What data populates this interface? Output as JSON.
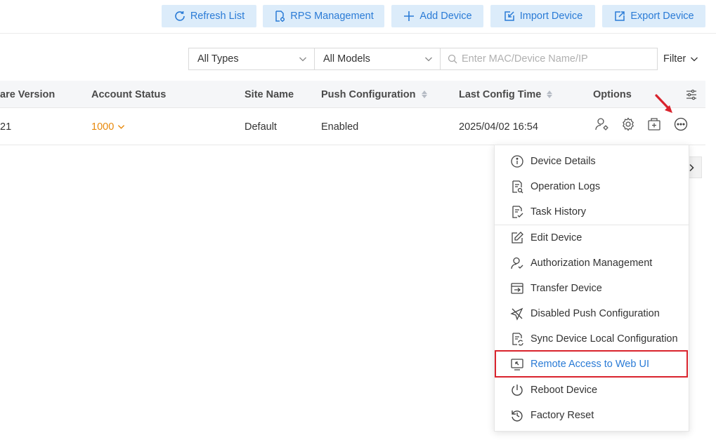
{
  "toolbar": {
    "refresh": "Refresh List",
    "rps": "RPS Management",
    "add": "Add Device",
    "import": "Import Device",
    "export": "Export Device"
  },
  "filters": {
    "types": "All Types",
    "models": "All Models",
    "search_placeholder": "Enter MAC/Device Name/IP",
    "filter": "Filter"
  },
  "table": {
    "headers": {
      "firmware": "are Version",
      "account_status": "Account Status",
      "site_name": "Site Name",
      "push_config": "Push Configuration",
      "last_config_time": "Last Config Time",
      "options": "Options"
    },
    "row": {
      "firmware": "21",
      "account_status": "1000",
      "site_name": "Default",
      "push_config": "Enabled",
      "last_config_time": "2025/04/02 16:54"
    }
  },
  "menu": {
    "items": [
      "Device Details",
      "Operation Logs",
      "Task History",
      "Edit Device",
      "Authorization Management",
      "Transfer Device",
      "Disabled Push Configuration",
      "Sync Device Local Configuration",
      "Remote Access to Web UI",
      "Reboot Device",
      "Factory Reset"
    ],
    "active_item": "Remote Access to Web UI"
  },
  "colors": {
    "accent": "#2a7bd6",
    "button_bg": "#dcecfa",
    "warning": "#e8890c",
    "highlight": "#d9232d"
  }
}
